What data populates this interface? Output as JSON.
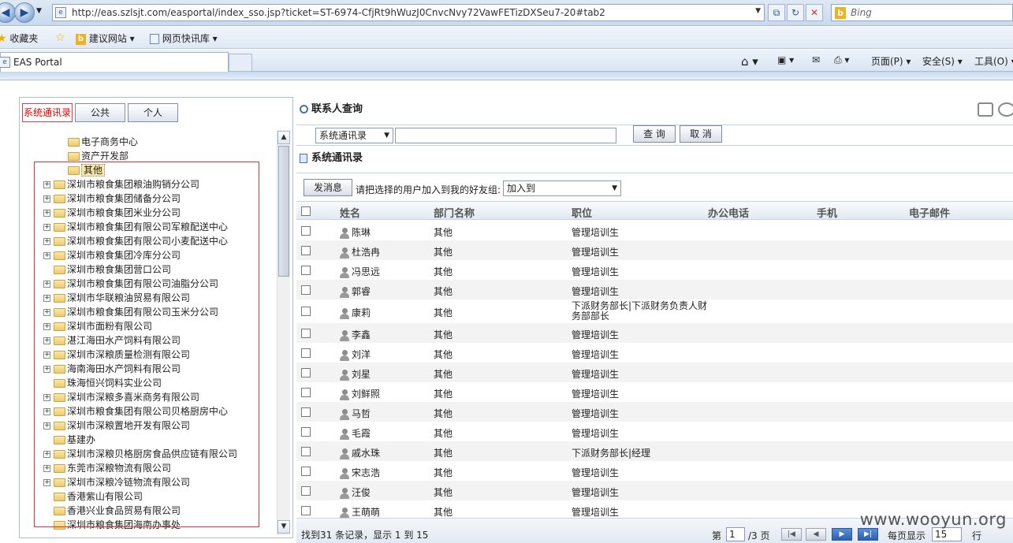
{
  "browser": {
    "url": "http://eas.szlsjt.com/easportal/index_sso.jsp?ticket=ST-6974-CfjRt9hWuzJ0CnvcNvy72VawFETizDXSeu7-20#tab2",
    "search_engine": "Bing",
    "favorites_label": "收藏夹",
    "fav_items": [
      "建议网站 ▾",
      "网页快讯库 ▾"
    ],
    "tab_title": "EAS Portal",
    "cmd_items": [
      "页面(P) ▾",
      "安全(S) ▾",
      "工具(O) ▾"
    ]
  },
  "left_panel": {
    "tabs": [
      "系统通讯录",
      "公共",
      "个人"
    ],
    "tree": [
      {
        "label": "电子商务中心",
        "expandable": false,
        "level": 2
      },
      {
        "label": "资产开发部",
        "expandable": false,
        "level": 2
      },
      {
        "label": "其他",
        "expandable": false,
        "level": 2,
        "selected": true
      },
      {
        "label": "深圳市粮食集团粮油购销分公司",
        "expandable": true,
        "level": 1
      },
      {
        "label": "深圳市粮食集团储备分公司",
        "expandable": true,
        "level": 1
      },
      {
        "label": "深圳市粮食集团米业分公司",
        "expandable": true,
        "level": 1
      },
      {
        "label": "深圳市粮食集团有限公司军粮配送中心",
        "expandable": true,
        "level": 1
      },
      {
        "label": "深圳市粮食集团有限公司小麦配送中心",
        "expandable": true,
        "level": 1
      },
      {
        "label": "深圳市粮食集团冷库分公司",
        "expandable": true,
        "level": 1
      },
      {
        "label": "深圳市粮食集团营口公司",
        "expandable": false,
        "level": 1
      },
      {
        "label": "深圳市粮食集团有限公司油脂分公司",
        "expandable": true,
        "level": 1
      },
      {
        "label": "深圳市华联粮油贸易有限公司",
        "expandable": true,
        "level": 1
      },
      {
        "label": "深圳市粮食集团有限公司玉米分公司",
        "expandable": true,
        "level": 1
      },
      {
        "label": "深圳市面粉有限公司",
        "expandable": true,
        "level": 1
      },
      {
        "label": "湛江海田水产饲料有限公司",
        "expandable": true,
        "level": 1
      },
      {
        "label": "深圳市深粮质量检测有限公司",
        "expandable": true,
        "level": 1
      },
      {
        "label": "海南海田水产饲料有限公司",
        "expandable": true,
        "level": 1
      },
      {
        "label": "珠海恒兴饲料实业公司",
        "expandable": false,
        "level": 1
      },
      {
        "label": "深圳市深粮多喜米商务有限公司",
        "expandable": true,
        "level": 1
      },
      {
        "label": "深圳市粮食集团有限公司贝格厨房中心",
        "expandable": true,
        "level": 1
      },
      {
        "label": "深圳市深粮置地开发有限公司",
        "expandable": true,
        "level": 1
      },
      {
        "label": "基建办",
        "expandable": false,
        "level": 1
      },
      {
        "label": "深圳市深粮贝格厨房食品供应链有限公司",
        "expandable": true,
        "level": 1
      },
      {
        "label": "东莞市深粮物流有限公司",
        "expandable": true,
        "level": 1
      },
      {
        "label": "深圳市深粮冷链物流有限公司",
        "expandable": true,
        "level": 1
      },
      {
        "label": "香港紫山有限公司",
        "expandable": false,
        "level": 1
      },
      {
        "label": "香港兴业食品贸易有限公司",
        "expandable": false,
        "level": 1
      },
      {
        "label": "深圳市粮食集团海南办事处",
        "expandable": false,
        "level": 1
      }
    ]
  },
  "right_panel": {
    "title": "联系人查询",
    "search_scope": "系统通讯录",
    "search_value": "",
    "query_btn": "查 询",
    "cancel_btn": "取 消",
    "section_title": "系统通讯录",
    "send_btn": "发消息",
    "add_label": "请把选择的用户加入到我的好友组:",
    "add_select": "加入到",
    "columns": [
      "姓名",
      "部门名称",
      "职位",
      "办公电话",
      "手机",
      "电子邮件"
    ],
    "rows": [
      {
        "name": "陈琳",
        "dept": "其他",
        "title": "管理培训生"
      },
      {
        "name": "杜浩冉",
        "dept": "其他",
        "title": "管理培训生"
      },
      {
        "name": "冯思远",
        "dept": "其他",
        "title": "管理培训生"
      },
      {
        "name": "郭睿",
        "dept": "其他",
        "title": "管理培训生"
      },
      {
        "name": "康莉",
        "dept": "其他",
        "title": "下派财务部长|下派财务负责人财",
        "title2": "务部部长"
      },
      {
        "name": "李鑫",
        "dept": "其他",
        "title": "管理培训生"
      },
      {
        "name": "刘洋",
        "dept": "其他",
        "title": "管理培训生"
      },
      {
        "name": "刘星",
        "dept": "其他",
        "title": "管理培训生"
      },
      {
        "name": "刘鲜照",
        "dept": "其他",
        "title": "管理培训生"
      },
      {
        "name": "马哲",
        "dept": "其他",
        "title": "管理培训生"
      },
      {
        "name": "毛霞",
        "dept": "其他",
        "title": "管理培训生"
      },
      {
        "name": "戚水珠",
        "dept": "其他",
        "title": "下派财务部长|经理"
      },
      {
        "name": "宋志浩",
        "dept": "其他",
        "title": "管理培训生"
      },
      {
        "name": "汪俊",
        "dept": "其他",
        "title": "管理培训生"
      },
      {
        "name": "王萌萌",
        "dept": "其他",
        "title": "管理培训生"
      }
    ],
    "footer": {
      "found": "找到31 条记录，显示 1 到 15",
      "page_prefix": "第",
      "page": "1",
      "page_total": "/3 页",
      "per_page_label": "每页显示",
      "per_page": "15",
      "per_page_unit": "行"
    }
  },
  "watermark": "www.wooyun.org"
}
